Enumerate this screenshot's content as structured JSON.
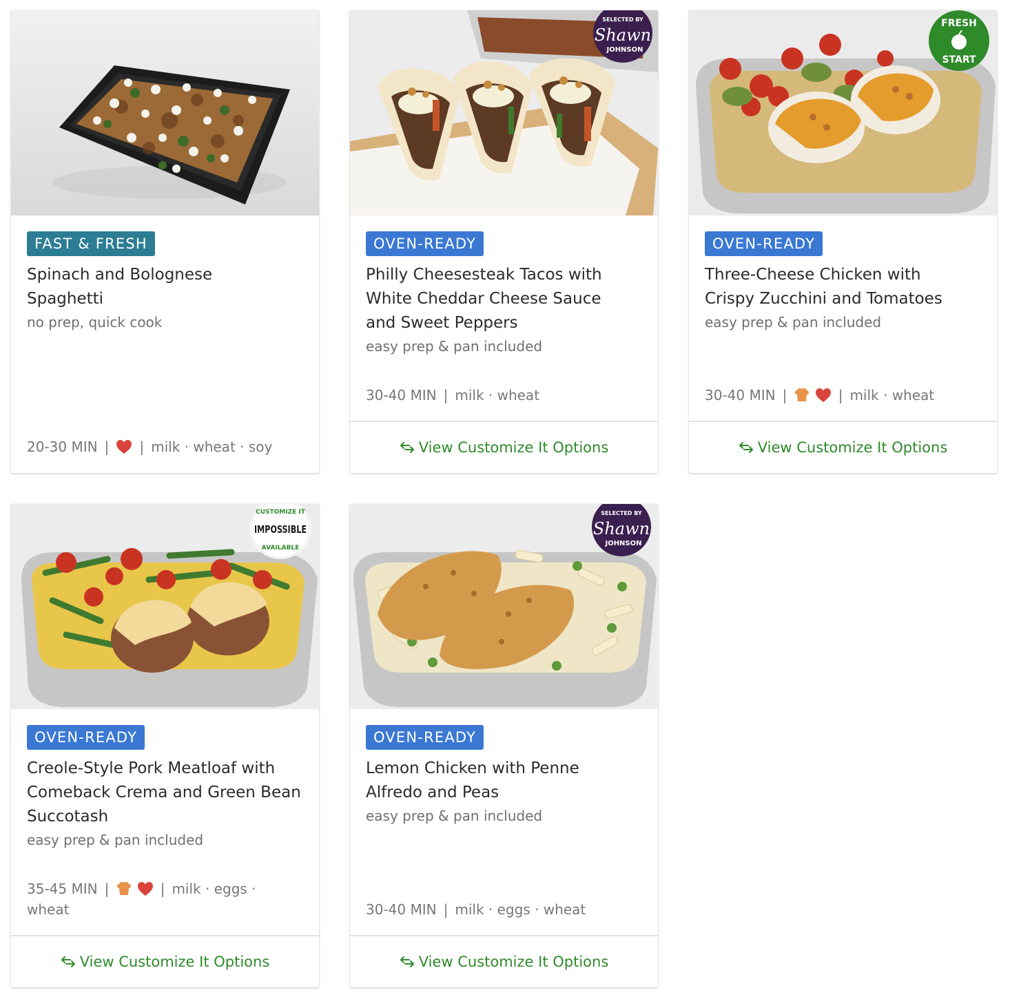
{
  "cards": [
    {
      "badge": "FAST & FRESH",
      "title": "Spinach and Bolognese Spaghetti",
      "subtitle": "no prep, quick cook",
      "time": "20-30 MIN",
      "separator": "|",
      "icons": [
        "heart-icon"
      ],
      "allergens": "milk · wheat · soy"
    },
    {
      "badge": "OVEN-READY",
      "title": "Philly Cheesesteak Tacos with White Cheddar Cheese Sauce and Sweet Peppers",
      "subtitle": "easy prep & pan included",
      "time": "30-40 MIN",
      "separator": "|",
      "allergens": "milk · wheat",
      "cta": "View Customize It Options",
      "seal": {
        "top": "SELECTED BY",
        "script": "Shawn",
        "bottom": "JOHNSON"
      }
    },
    {
      "badge": "OVEN-READY",
      "title": "Three-Cheese Chicken with Crispy Zucchini and Tomatoes",
      "subtitle": "easy prep & pan included",
      "time": "30-40 MIN",
      "separator": "|",
      "icons": [
        "chef-hat-icon",
        "heart-icon"
      ],
      "allergens": "milk · wheat",
      "cta": "View Customize It Options",
      "seal": {
        "top": "FRESH",
        "bottom": "START"
      }
    },
    {
      "badge": "OVEN-READY",
      "title": "Creole-Style Pork Meatloaf with Comeback Crema and Green Bean Succotash",
      "subtitle": "easy prep & pan included",
      "time": "35-45 MIN",
      "separator": "|",
      "icons": [
        "chef-hat-icon",
        "heart-icon"
      ],
      "allergens": "milk · eggs · wheat",
      "cta": "View Customize It Options",
      "seal": {
        "top": "CUSTOMIZE IT",
        "middle": "IMPOSSIBLE",
        "bottom": "AVAILABLE"
      }
    },
    {
      "badge": "OVEN-READY",
      "title": "Lemon Chicken with Penne Alfredo and Peas",
      "subtitle": "easy prep & pan included",
      "time": "30-40 MIN",
      "separator": "|",
      "allergens": "milk · eggs · wheat",
      "cta": "View Customize It Options",
      "seal": {
        "top": "SELECTED BY",
        "script": "Shawn",
        "bottom": "JOHNSON"
      }
    }
  ],
  "colors": {
    "fast_badge": "#2c7d93",
    "oven_badge": "#3a78d4",
    "cta_green": "#2f8a2a",
    "heart": "#d9453b",
    "chef_hat": "#e8924a",
    "shawn_seal": "#3b1f4f",
    "fresh_seal": "#2f8a2a"
  }
}
